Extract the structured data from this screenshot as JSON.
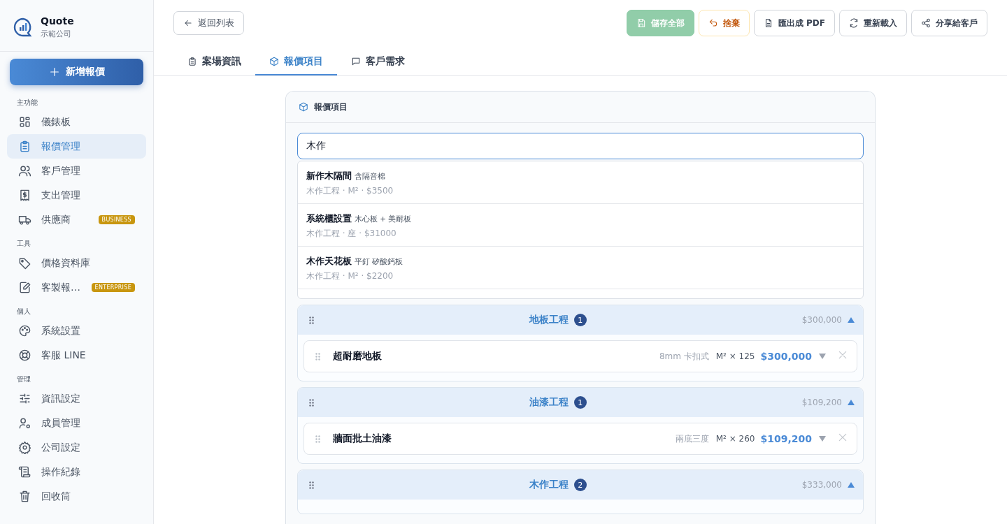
{
  "brand": {
    "name": "Quote",
    "company": "示範公司"
  },
  "new_button": "新增報價",
  "sidebar": [
    {
      "heading": "主功能",
      "items": [
        {
          "label": "儀錶板",
          "selected": false
        },
        {
          "label": "報價管理",
          "selected": true
        },
        {
          "label": "客戶管理",
          "selected": false
        },
        {
          "label": "支出管理",
          "selected": false
        },
        {
          "label": "供應商",
          "selected": false,
          "badge": "BUSINESS"
        }
      ]
    },
    {
      "heading": "工具",
      "items": [
        {
          "label": "價格資料庫",
          "selected": false
        },
        {
          "label": "客製報…",
          "selected": false,
          "badge": "ENTERPRISE"
        }
      ]
    },
    {
      "heading": "個人",
      "items": [
        {
          "label": "系統設置",
          "selected": false
        },
        {
          "label": "客服 LINE",
          "selected": false
        }
      ]
    },
    {
      "heading": "管理",
      "items": [
        {
          "label": "資訊設定",
          "selected": false
        },
        {
          "label": "成員管理",
          "selected": false
        },
        {
          "label": "公司設定",
          "selected": false
        },
        {
          "label": "操作紀錄",
          "selected": false
        },
        {
          "label": "回收筒",
          "selected": false
        }
      ]
    }
  ],
  "back_button": "返回列表",
  "actions": [
    {
      "label": "儲存全部",
      "kind": "primary",
      "disabled": true
    },
    {
      "label": "捨棄",
      "kind": "warning",
      "disabled": false
    },
    {
      "label": "匯出成 PDF",
      "kind": "default",
      "disabled": false
    },
    {
      "label": "重新載入",
      "kind": "default",
      "disabled": false
    },
    {
      "label": "分享給客戶",
      "kind": "default",
      "disabled": false
    }
  ],
  "tabs": [
    {
      "label": "案場資訊",
      "selected": false
    },
    {
      "label": "報價項目",
      "selected": true
    },
    {
      "label": "客戶需求",
      "selected": false
    }
  ],
  "panel": {
    "title": "報價項目",
    "search": {
      "value": "木作"
    },
    "suggestions": [
      {
        "name": "新作木隔間",
        "note": "含隔音棉",
        "meta": "木作工程 · M² · $3500"
      },
      {
        "name": "系統櫃設置",
        "note": "木心板 + 美耐板",
        "meta": "木作工程 · 座 · $31000"
      },
      {
        "name": "木作天花板",
        "note": "平釘 矽酸鈣板",
        "meta": "木作工程 · M² · $2200"
      }
    ],
    "groups": [
      {
        "title": "地板工程",
        "count": "1",
        "total": "$300,000",
        "expanded": true,
        "items": [
          {
            "name": "超耐磨地板",
            "spec": "8mm 卡扣式",
            "qty": "M² × 125",
            "amount": "$300,000"
          }
        ]
      },
      {
        "title": "油漆工程",
        "count": "1",
        "total": "$109,200",
        "expanded": true,
        "items": [
          {
            "name": "牆面批土油漆",
            "spec": "兩底三度",
            "qty": "M² × 260",
            "amount": "$109,200"
          }
        ]
      },
      {
        "title": "木作工程",
        "count": "2",
        "total": "$333,000",
        "expanded": true
      }
    ]
  }
}
